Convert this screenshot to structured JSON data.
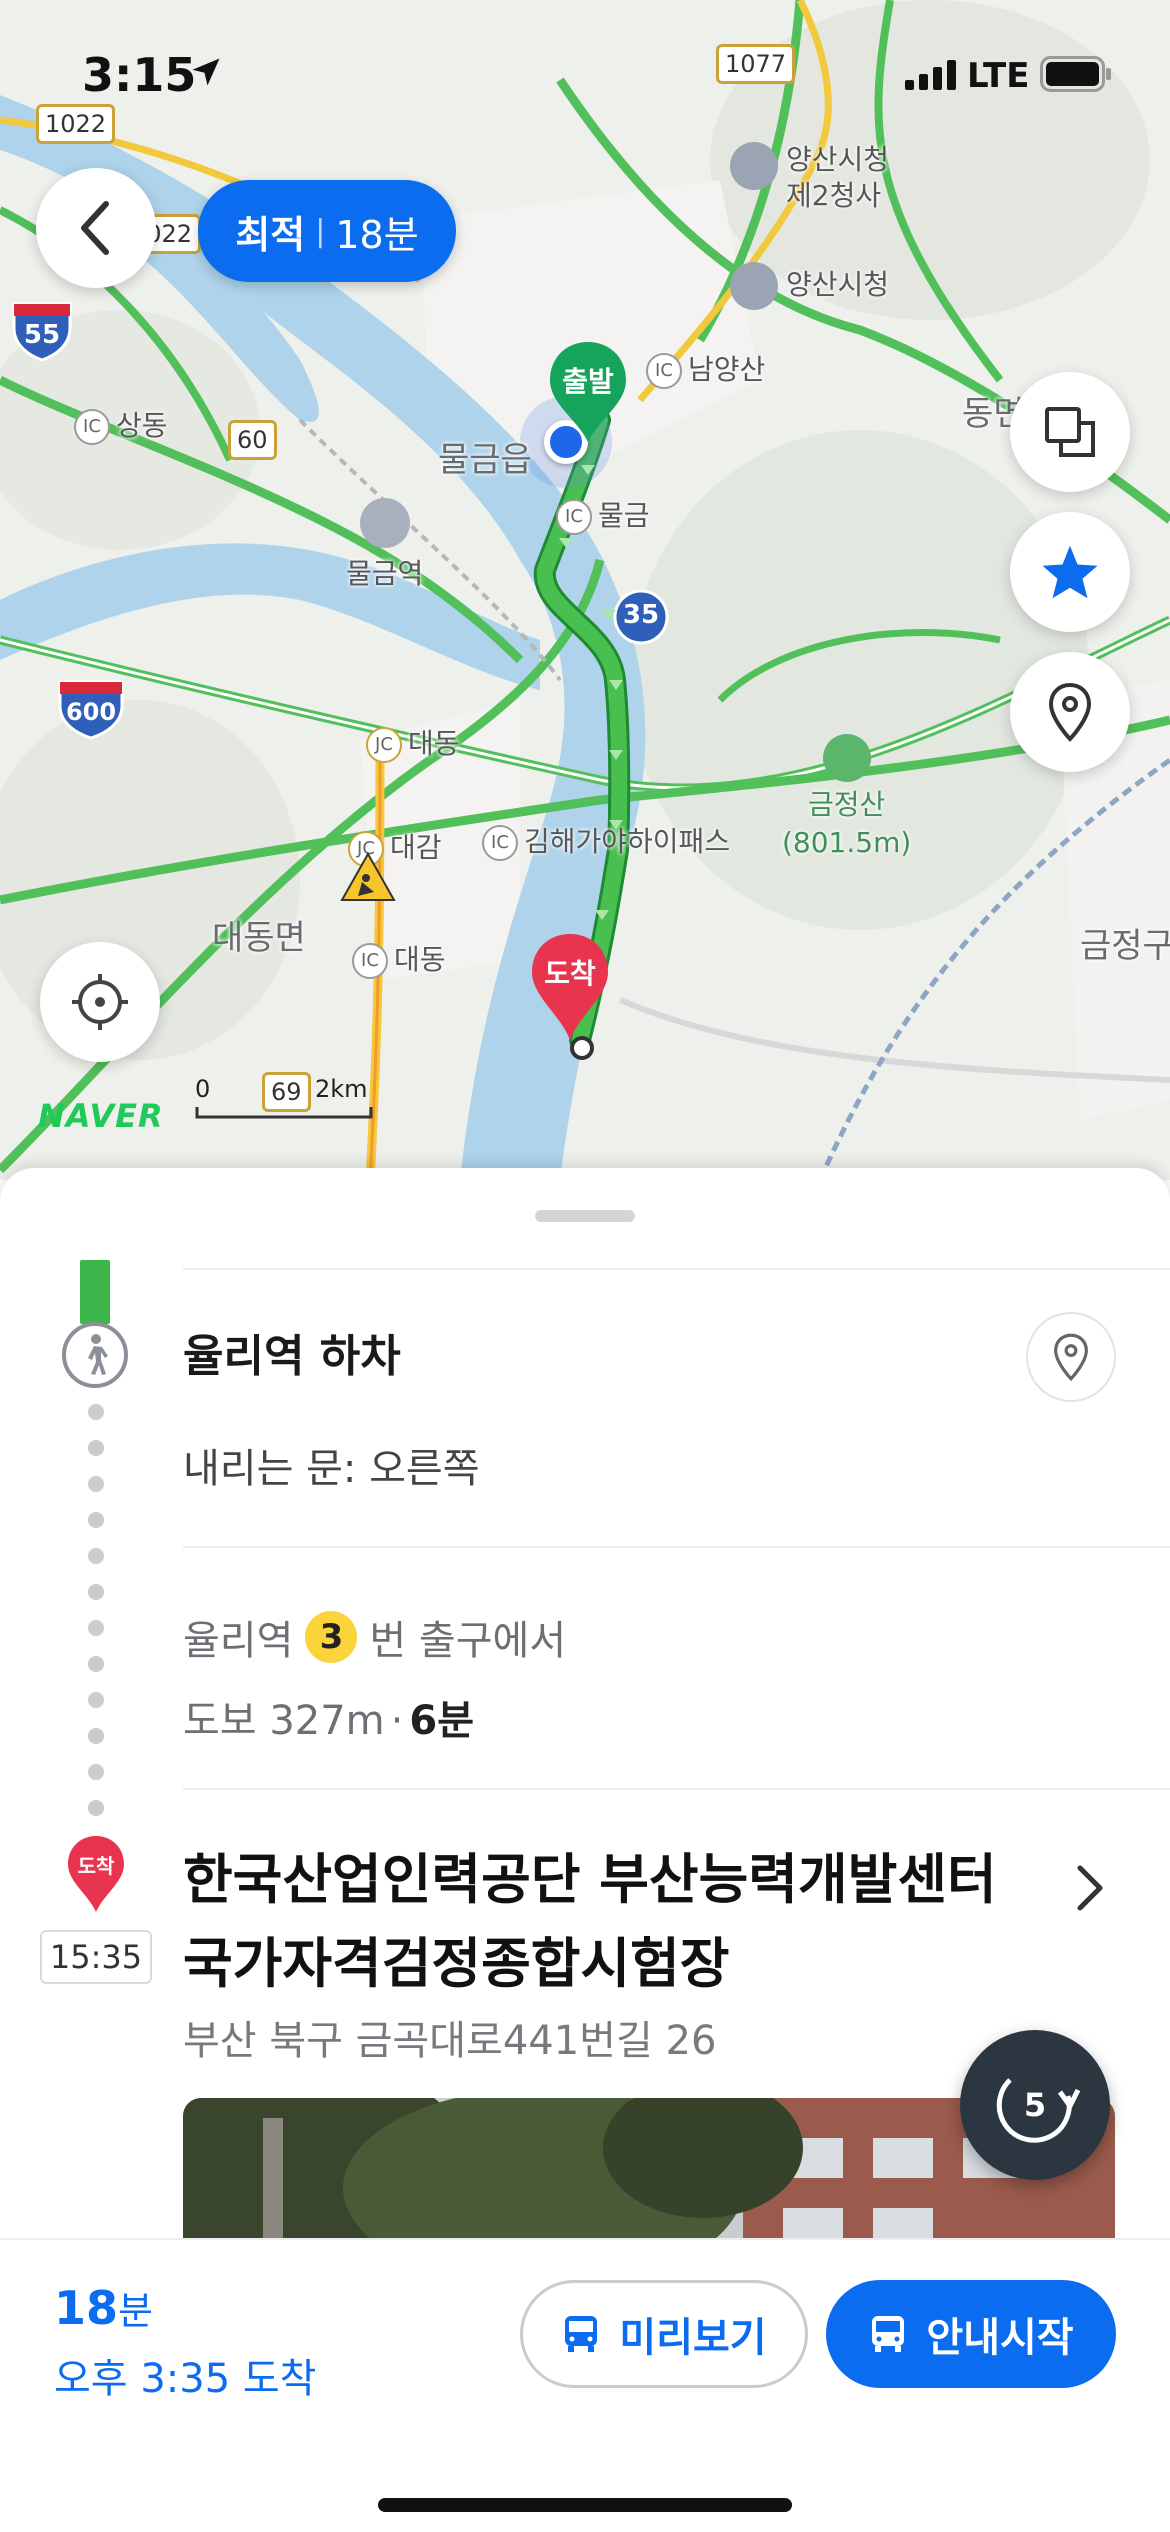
{
  "status_bar": {
    "time": "3:15",
    "network": "LTE"
  },
  "map": {
    "route_chip": {
      "label": "최적",
      "duration": "18분"
    },
    "labels": {
      "yangsan_hall_2": "양산시청\n제2청사",
      "yangsan_hall_2_line1": "양산시청",
      "yangsan_hall_2_line2": "제2청사",
      "yangsan_hall": "양산시청",
      "namyangsan": "남양산",
      "sangdong": "상동",
      "mulgeum_eup": "물금읍",
      "mulgeum_ic": "물금",
      "mulgeum_station": "물금역",
      "daedong_jc": "대동",
      "daegam_jc": "대감",
      "gimhae_pass": "김해가야하이패스",
      "daedong_myeon": "대동면",
      "daedong_ic": "대동",
      "geumjeongsan": "금정산",
      "geumjeongsan_height": "(801.5m)",
      "dong": "동면",
      "geumjeong": "금정구"
    },
    "highways": {
      "h1022a": "1022",
      "h1022b": "1022",
      "h1077": "1077",
      "h60": "60",
      "h69": "69",
      "h35": "35",
      "h55": "55",
      "h600": "600"
    },
    "pins": {
      "start": "출발",
      "end": "도착"
    },
    "brand": "NAVER",
    "scale": {
      "zero": "0",
      "dist": "2km"
    }
  },
  "sheet": {
    "step_title": "율리역 하차",
    "door_info": "내리는 문: 오른쪽",
    "exit_station": "율리역",
    "exit_number": "3",
    "exit_suffix": "번 출구에서",
    "walk_label": "도보 327m",
    "walk_time": "6분",
    "dest_badge": "도착",
    "arrival_time": "15:35",
    "destination_name": "한국산업인력공단 부산능력개발센터국가자격검정종합시험장",
    "destination_address": "부산 북구 금곡대로441번길 26",
    "reroute_count": "5"
  },
  "bottom_bar": {
    "minutes": "18",
    "minutes_unit": "분",
    "arrival": "오후 3:35 도착",
    "preview_label": "미리보기",
    "start_label": "안내시작"
  },
  "colors": {
    "accent": "#0C6CF0",
    "route": "#3CB54A",
    "end_pin": "#E8344E",
    "start_pin": "#16A45C"
  }
}
